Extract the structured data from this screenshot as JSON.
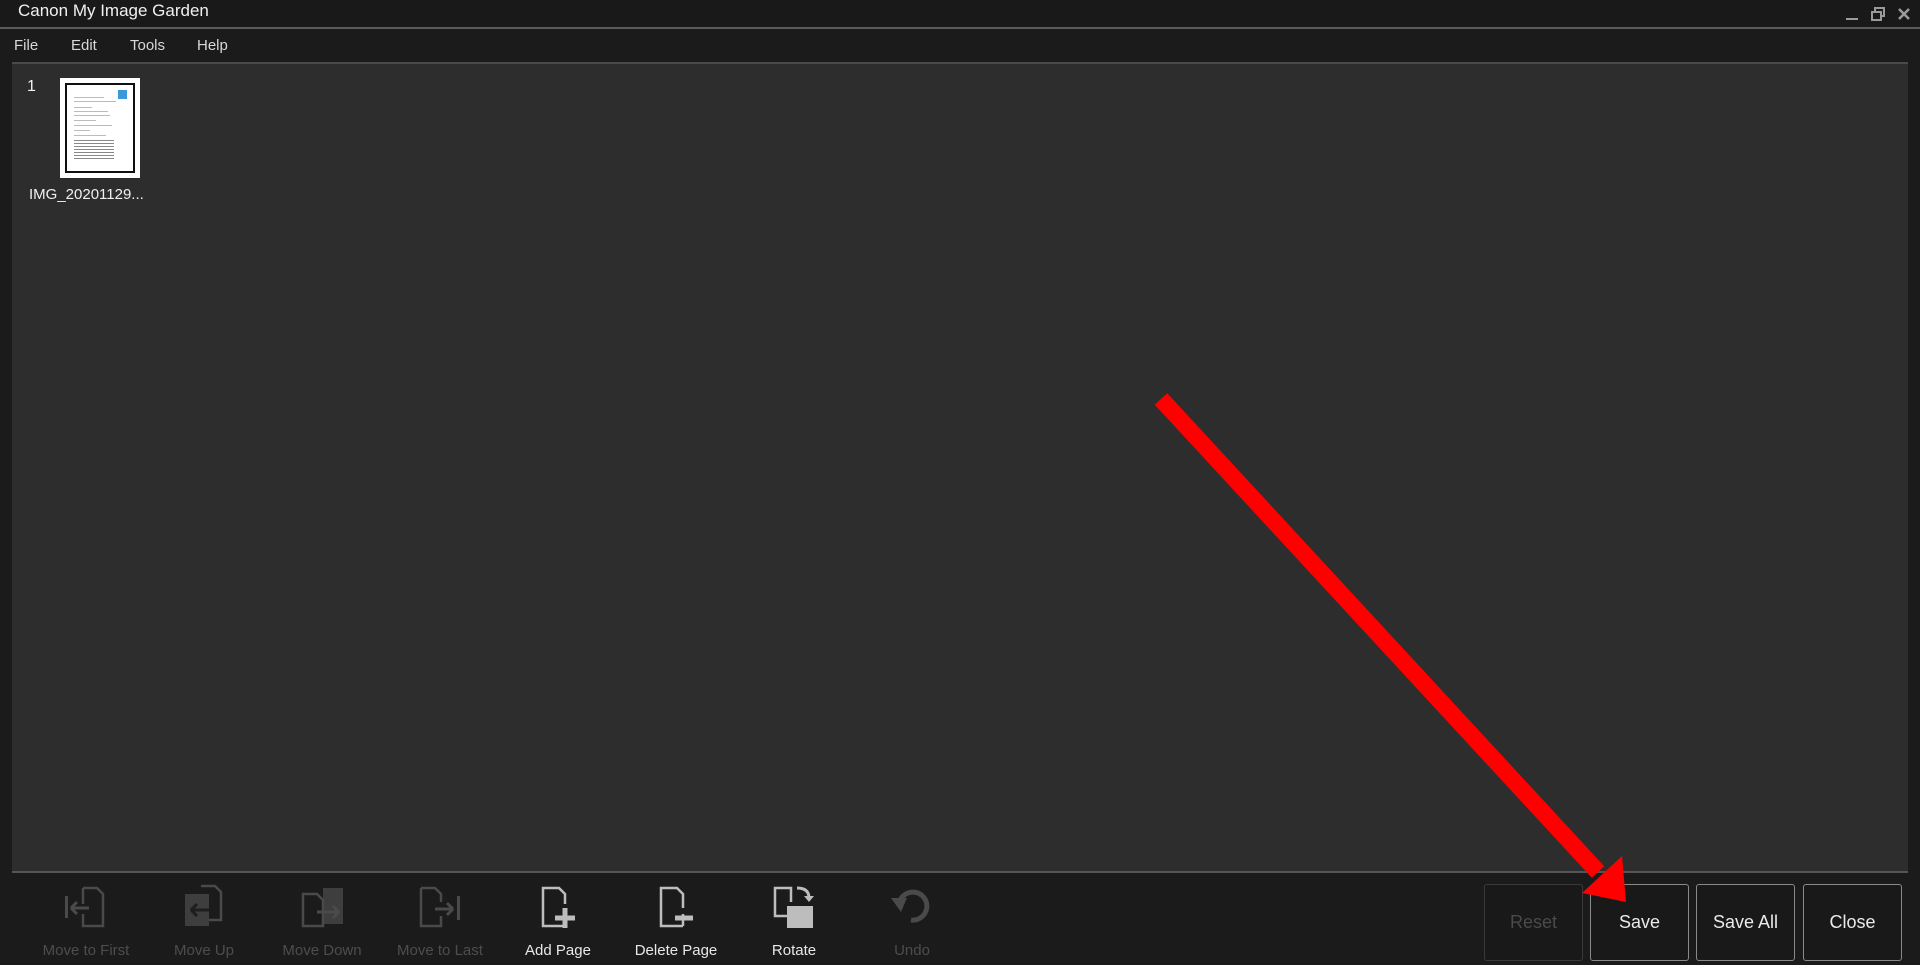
{
  "window": {
    "title": "Canon My Image Garden",
    "controls": [
      "minimize",
      "restore",
      "close"
    ]
  },
  "menu": {
    "items": [
      "File",
      "Edit",
      "Tools",
      "Help"
    ]
  },
  "pages": [
    {
      "number": "1",
      "filename": "IMG_20201129...",
      "selected": true
    }
  ],
  "toolbar": {
    "tools": [
      {
        "label": "Move to First",
        "icon": "move-to-first-icon",
        "enabled": false
      },
      {
        "label": "Move Up",
        "icon": "move-up-icon",
        "enabled": false
      },
      {
        "label": "Move Down",
        "icon": "move-down-icon",
        "enabled": false
      },
      {
        "label": "Move to Last",
        "icon": "move-to-last-icon",
        "enabled": false
      },
      {
        "label": "Add Page",
        "icon": "add-page-icon",
        "enabled": true
      },
      {
        "label": "Delete Page",
        "icon": "delete-page-icon",
        "enabled": true
      },
      {
        "label": "Rotate",
        "icon": "rotate-icon",
        "enabled": true
      },
      {
        "label": "Undo",
        "icon": "undo-icon",
        "enabled": false
      }
    ]
  },
  "buttons": {
    "reset": {
      "label": "Reset",
      "enabled": false
    },
    "save": {
      "label": "Save",
      "enabled": true
    },
    "save_all": {
      "label": "Save All",
      "enabled": true
    },
    "close": {
      "label": "Close",
      "enabled": true
    }
  },
  "annotation": {
    "type": "arrow",
    "color": "#ff0000",
    "points_to": "save-button"
  }
}
